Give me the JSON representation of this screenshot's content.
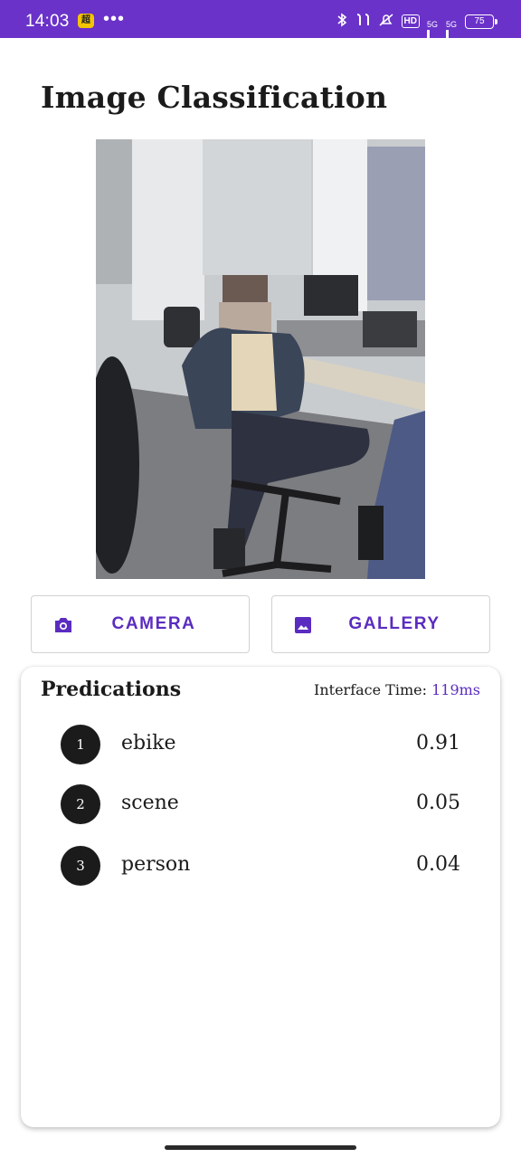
{
  "status_bar": {
    "time": "14:03",
    "app_icon": "超",
    "more": "•••",
    "hd": "HD",
    "network_1": "5G",
    "network_2": "5G",
    "battery": "75",
    "icons": [
      "bluetooth-icon",
      "earbuds-icon",
      "silent-icon",
      "hd-icon",
      "signal-icon",
      "signal-icon",
      "battery-icon"
    ]
  },
  "app": {
    "title": "Image Classification"
  },
  "buttons": {
    "camera": {
      "label": "CAMERA",
      "icon": "camera-icon"
    },
    "gallery": {
      "label": "GALLERY",
      "icon": "image-icon"
    }
  },
  "predictions": {
    "title": "Predications",
    "time_label": "Interface Time:",
    "time_value": "119ms",
    "items": [
      {
        "rank": "1",
        "label": "ebike",
        "score": "0.91"
      },
      {
        "rank": "2",
        "label": "scene",
        "score": "0.05"
      },
      {
        "rank": "3",
        "label": "person",
        "score": "0.04"
      }
    ]
  },
  "colors": {
    "accent": "#5b2cc0",
    "status_bar": "#6a32c9",
    "text": "#1b1b1b"
  }
}
